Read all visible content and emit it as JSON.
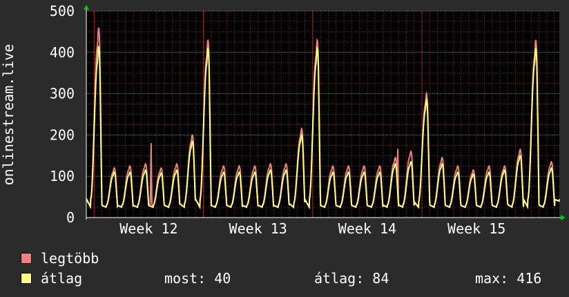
{
  "chart_data": {
    "type": "line",
    "ylabel": "onlinestream.live",
    "ylim": [
      0,
      500
    ],
    "y_ticks": [
      0,
      100,
      200,
      300,
      400,
      500
    ],
    "x_ticks": [
      "Week 12",
      "Week 13",
      "Week 14",
      "Week 15"
    ],
    "x_tick_days": [
      4,
      11,
      18,
      25
    ],
    "x_range_days": [
      0,
      30.3
    ],
    "grid": "dotted red",
    "series": [
      {
        "name": "legtöbb",
        "color": "#f08080",
        "daily_peak": [
          460,
          120,
          125,
          130,
          120,
          130,
          200,
          430,
          125,
          125,
          125,
          130,
          130,
          215,
          430,
          125,
          125,
          125,
          125,
          145,
          160,
          300,
          145,
          125,
          115,
          125,
          125,
          165,
          430,
          135,
          125
        ],
        "daily_min": [
          25,
          25,
          25,
          25,
          25,
          25,
          25,
          25,
          25,
          25,
          25,
          25,
          25,
          25,
          25,
          25,
          25,
          25,
          25,
          25,
          25,
          25,
          25,
          25,
          25,
          25,
          25,
          25,
          25,
          25,
          40
        ],
        "extra_spikes": [
          [
            4.15,
            183
          ],
          [
            19.95,
            170
          ]
        ]
      },
      {
        "name": "átlag",
        "color": "#ffff80",
        "daily_peak": [
          415,
          110,
          110,
          115,
          108,
          115,
          185,
          410,
          110,
          110,
          110,
          115,
          115,
          200,
          410,
          110,
          110,
          110,
          110,
          130,
          135,
          285,
          130,
          110,
          105,
          110,
          115,
          150,
          410,
          120,
          112
        ],
        "daily_min": [
          25,
          25,
          25,
          25,
          25,
          25,
          25,
          25,
          25,
          25,
          25,
          25,
          25,
          25,
          25,
          25,
          25,
          25,
          25,
          25,
          25,
          25,
          25,
          25,
          25,
          25,
          25,
          25,
          25,
          25,
          40
        ]
      }
    ]
  },
  "legend": {
    "items": [
      {
        "label": "legtöbb",
        "color": "#f08080"
      },
      {
        "label": "átlag",
        "color": "#ffff80"
      }
    ],
    "stats": {
      "now": "most: 40",
      "avg": "átlag: 84",
      "max": "max: 416"
    }
  }
}
